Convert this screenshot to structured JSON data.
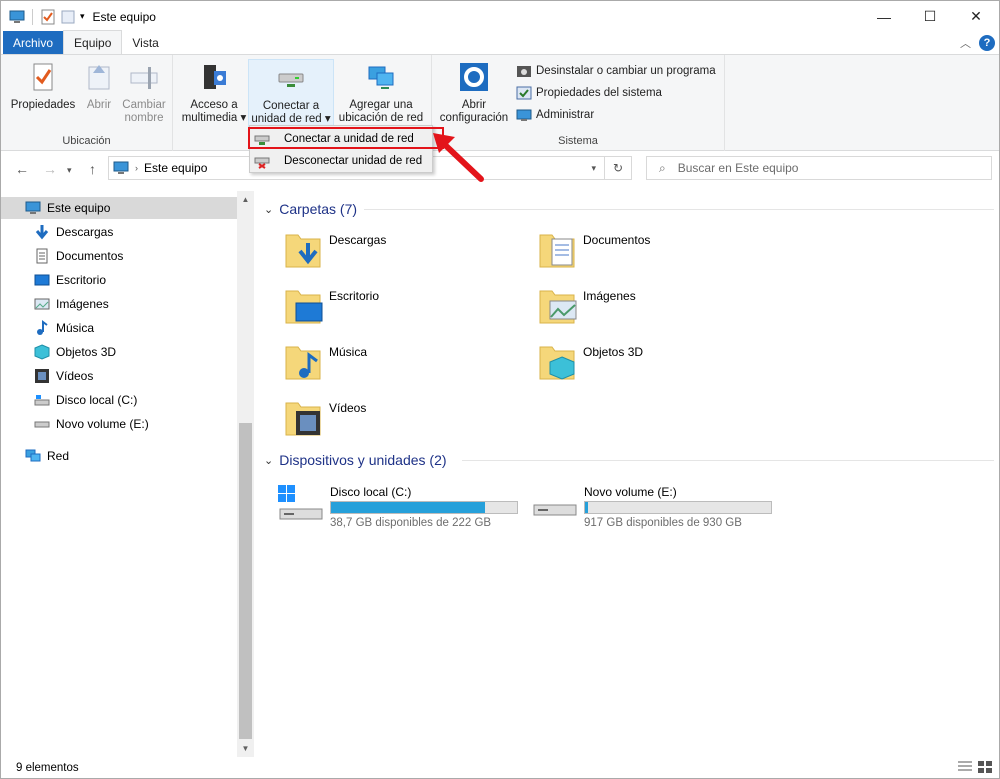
{
  "window": {
    "title": "Este equipo",
    "controls": {
      "minimize": "—",
      "maximize": "☐",
      "close": "✕"
    }
  },
  "tabs": [
    {
      "label": "Archivo"
    },
    {
      "label": "Equipo"
    },
    {
      "label": "Vista"
    }
  ],
  "ribbon": {
    "groups": {
      "ubicacion": "Ubicación",
      "sistema": "Sistema"
    },
    "buttons": {
      "propiedades": "Propiedades",
      "abrir": "Abrir",
      "cambiar_line1": "Cambiar",
      "cambiar_line2": "nombre",
      "acceso_line1": "Acceso a",
      "acceso_line2": "multimedia ▾",
      "conectar_line1": "Conectar a",
      "conectar_line2": "unidad de red ▾",
      "agregar_line1": "Agregar una",
      "agregar_line2": "ubicación de red",
      "config_line1": "Abrir",
      "config_line2": "configuración"
    },
    "system_items": [
      {
        "label": "Desinstalar o cambiar un programa"
      },
      {
        "label": "Propiedades del sistema"
      },
      {
        "label": "Administrar"
      }
    ]
  },
  "dropdown": {
    "items": [
      {
        "label": "Conectar a unidad de red"
      },
      {
        "label": "Desconectar unidad de red"
      }
    ],
    "highlight_color": "#e3141a"
  },
  "address": {
    "path": "Este equipo",
    "search_placeholder": "Buscar en Este equipo"
  },
  "nav_pane": {
    "items": [
      {
        "label": "Este equipo",
        "icon": "computer-icon"
      },
      {
        "label": "Descargas",
        "icon": "downloads-icon"
      },
      {
        "label": "Documentos",
        "icon": "documents-icon"
      },
      {
        "label": "Escritorio",
        "icon": "desktop-icon"
      },
      {
        "label": "Imágenes",
        "icon": "pictures-icon"
      },
      {
        "label": "Música",
        "icon": "music-icon"
      },
      {
        "label": "Objetos 3D",
        "icon": "objects-3d-icon"
      },
      {
        "label": "Vídeos",
        "icon": "videos-icon"
      },
      {
        "label": "Disco local (C:)",
        "icon": "drive-icon"
      },
      {
        "label": "Novo volume (E:)",
        "icon": "drive-icon"
      },
      {
        "label": "Red",
        "icon": "network-icon"
      }
    ]
  },
  "content": {
    "folders_header": "Carpetas (7)",
    "folders": [
      {
        "name": "Descargas",
        "badge": "downloads"
      },
      {
        "name": "Documentos",
        "badge": "documents"
      },
      {
        "name": "Escritorio",
        "badge": "desktop"
      },
      {
        "name": "Imágenes",
        "badge": "pictures"
      },
      {
        "name": "Música",
        "badge": "music"
      },
      {
        "name": "Objetos 3D",
        "badge": "objects-3d"
      },
      {
        "name": "Vídeos",
        "badge": "videos"
      }
    ],
    "devices_header": "Dispositivos y unidades (2)",
    "drives": [
      {
        "name": "Disco local (C:)",
        "free": "38,7 GB disponibles de 222 GB",
        "used_fraction": 0.826
      },
      {
        "name": "Novo volume (E:)",
        "free": "917 GB disponibles de 930 GB",
        "used_fraction": 0.014
      }
    ]
  },
  "status": {
    "count": "9 elementos"
  },
  "colors": {
    "accent": "#1e6cc0",
    "bar": "#26a0da",
    "section": "#1e3287"
  }
}
